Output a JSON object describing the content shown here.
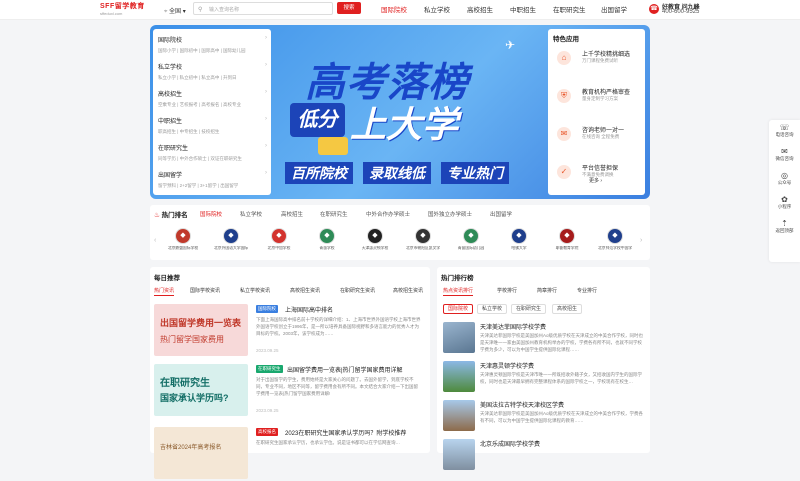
{
  "header": {
    "logo": "SFF留学教育",
    "logo_sub": "sffeduxl.com",
    "city": "全国",
    "search_placeholder": "输入查询名称",
    "search_button": "搜索",
    "nav": [
      "国际院校",
      "私立学校",
      "高校招生",
      "中职招生",
      "在职研究生",
      "出国留学"
    ],
    "phone_line1": "好教育 问九峰",
    "phone_line2": "400-600-9525"
  },
  "menu": [
    {
      "title": "国际院校",
      "sub": "国际小学 | 国际初中 | 国际高中 | 国际幼儿园"
    },
    {
      "title": "私立学校",
      "sub": "私立小学 | 私立初中 | 私立高中 | 升到日"
    },
    {
      "title": "高校招生",
      "sub": "空乘专业 | 艺校报考 | 高考报名 | 高校专业"
    },
    {
      "title": "中职招生",
      "sub": "职高招生 | 中专招生 | 技校招生"
    },
    {
      "title": "在职研究生",
      "sub": "同等学历 | 中外合作硕士 | 双证在职研究生"
    },
    {
      "title": "出国留学",
      "sub": "留学预科 | 2+2留学 | 3+1留学 | 出国留学"
    }
  ],
  "banner": {
    "line1": "高考落榜",
    "line2": "低分",
    "line3": "上大学",
    "tags": [
      "百所院校",
      "录取线低",
      "专业热门"
    ]
  },
  "features": {
    "title": "特色应用",
    "items": [
      {
        "title": "上千学校精挑细选",
        "sub": "万门课程免费试听"
      },
      {
        "title": "教育机构严格审查",
        "sub": "量身定制学习方案"
      },
      {
        "title": "咨询老师一对一",
        "sub": "在线咨询 全程免费"
      },
      {
        "title": "平台信誉担保",
        "sub": "不满意免费调换"
      }
    ],
    "more": "更多 ›"
  },
  "ranking": {
    "title": "热门排名",
    "tabs": [
      "国际院校",
      "私立学校",
      "高校招生",
      "在职研究生",
      "中外合作办学硕士",
      "国外独立办学硕士",
      "出国留学"
    ],
    "schools": [
      {
        "name": "北京鼎盛国际学校",
        "color": "#c0392b"
      },
      {
        "name": "北京外国语大学国际学校",
        "color": "#1f3f8c"
      },
      {
        "name": "北京中加学校",
        "color": "#d3332e"
      },
      {
        "name": "青苗学校",
        "color": "#2e8b57"
      },
      {
        "name": "天津惠灵顿学校",
        "color": "#222222"
      },
      {
        "name": "北京市朝阳区凯文学校",
        "color": "#333333"
      },
      {
        "name": "青苗国际幼儿园",
        "color": "#2e8b57"
      },
      {
        "name": "哈佛大学",
        "color": "#1f3f8c"
      },
      {
        "name": "耶鲁教育学院",
        "color": "#a61c1c"
      },
      {
        "name": "北京师范学校中国学校",
        "color": "#1f3f8c"
      }
    ]
  },
  "daily": {
    "title": "每日推荐",
    "tabs": [
      "热门资讯",
      "国际学校资讯",
      "私立学校资讯",
      "高校招生资讯",
      "在职研究生资讯",
      "高校招生资讯"
    ],
    "articles": [
      {
        "badge": "国际院校",
        "title": "上海国际高中排名",
        "desc": "下面上海国际高中排名前十学校的详细介绍：1、上海市世界外国语学校上海市世界外国语学校创立于1996年，是一所以培养具备国际视野和多语言能力的优秀人才为目标的学校。2003年，该学校成为……",
        "date": "2023.09.25",
        "thumb1": "出国留学费用一览表",
        "thumb2": "热门留学国家费用"
      },
      {
        "badge": "在职研究生",
        "title": "出国留学费用一览表|热门留学国家费用详解",
        "desc": "对于出国留学的学生，费用始终是大家关心的问题了。去国外留学，到底学校不同，专业不同，地区不同等，留学费用会有所不同。本文结合大家介绍一下出国留学费用一览表|热门留学国家费用详解!",
        "date": "2023.09.25",
        "thumb1": "在职研究生",
        "thumb2": "国家承认学历吗?"
      },
      {
        "badge": "高校报名",
        "title": "2023在职研究生国家承认学历吗？附学校推荐",
        "desc": "在职研究生国家承认学历，也承认学位。说是证书都可以在学信网查询…",
        "date": "2023.09.25",
        "thumb1": "吉林省2024年高考报名",
        "thumb2": ""
      }
    ]
  },
  "hot": {
    "title": "热门排行榜",
    "tabs": [
      "热点资讯排行",
      "学校排行",
      "简章排行",
      "专业排行"
    ],
    "pills": [
      "国际院校",
      "私立学校",
      "在职研究生",
      "高校招生"
    ],
    "items": [
      {
        "title": "天津美达菲国际学校学费",
        "desc": "天津美达菲国际学校是美国加州Ao级优质学校在天津成立的中美合作学校，同时也是天津唯一一家由美国加州教育机构举办的学校，学费各有所不同，也就不同学校学费为多少，可以为中国学生提供国际化课程……"
      },
      {
        "title": "天津惠灵顿学校学费",
        "desc": "天津惠灵顿国际学校是天津市唯一一所既招收外籍子女，又招收国内学生的国际学校，同时也是天津最早拥有完整课程体系的国际学校之一，学校现有在校生…"
      },
      {
        "title": "美国法拉古特学校天津校区学费",
        "desc": "天津美达菲国际学校是美国加州Ao级优质学校在天津成立的中美合作学校，学费各有不同，可以为中国学生提供国际化课程的教育……"
      },
      {
        "title": "北京乐成国际学校学费",
        "desc": ""
      }
    ]
  },
  "sidebar": [
    "电话咨询",
    "微信咨询",
    "公众号",
    "小程序",
    "返回顶部"
  ],
  "colors": {
    "accent": "#e02020",
    "banner": "#3b8fe8",
    "feature": "#e8562a"
  }
}
